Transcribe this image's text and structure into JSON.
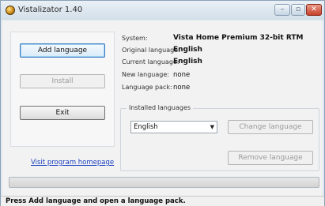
{
  "window": {
    "title": "Vistalizator 1.40",
    "minimize_label": "–",
    "maximize_label": "▫",
    "close_label": "✕",
    "icon": "app-globe-icon"
  },
  "left_panel": {
    "add_language_label": "Add language",
    "install_label": "Install",
    "exit_label": "Exit",
    "homepage_link": "Visit program homepage"
  },
  "info": {
    "system_label": "System:",
    "system_value": "Vista Home Premium 32-bit RTM",
    "original_label": "Original language:",
    "original_value": "English",
    "current_label": "Current language:",
    "current_value": "English",
    "new_label": "New language:",
    "new_value": "none",
    "pack_label": "Language pack:",
    "pack_value": "none"
  },
  "installed": {
    "group_title": "Installed languages",
    "selected": "English",
    "change_label": "Change language",
    "remove_label": "Remove language"
  },
  "progress": {
    "fraction": 0
  },
  "status": {
    "text": "Press Add language and open a language pack."
  }
}
